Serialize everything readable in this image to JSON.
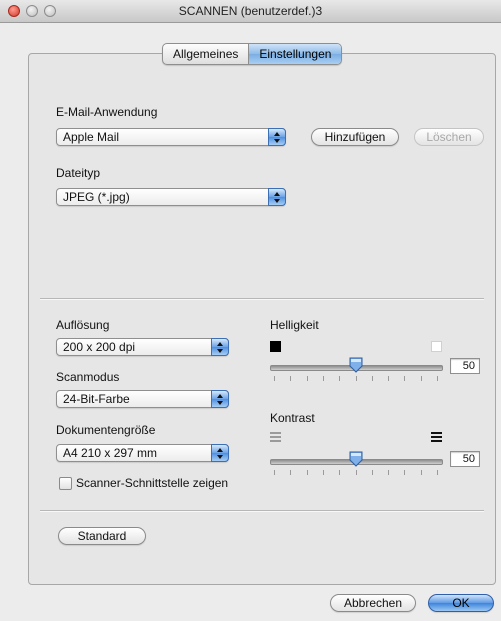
{
  "window": {
    "title": "SCANNEN (benutzerdef.)3"
  },
  "tabs": [
    "Allgemeines",
    "Einstellungen"
  ],
  "active_tab": "Einstellungen",
  "email": {
    "label": "E-Mail-Anwendung",
    "value": "Apple Mail",
    "add_button": "Hinzufügen",
    "delete_button": "Löschen"
  },
  "filetype": {
    "label": "Dateityp",
    "value": "JPEG (*.jpg)"
  },
  "resolution": {
    "label": "Auflösung",
    "value": "200 x 200 dpi"
  },
  "scanmode": {
    "label": "Scanmodus",
    "value": "24-Bit-Farbe"
  },
  "docsize": {
    "label": "Dokumentengröße",
    "value": "A4  210 x 297 mm"
  },
  "scanner_interface": {
    "label": "Scanner-Schnittstelle zeigen",
    "checked": false
  },
  "brightness": {
    "label": "Helligkeit",
    "value": "50",
    "level": 0.5
  },
  "contrast": {
    "label": "Kontrast",
    "value": "50",
    "level": 0.5
  },
  "standard_button": "Standard",
  "cancel_button": "Abbrechen",
  "ok_button": "OK"
}
